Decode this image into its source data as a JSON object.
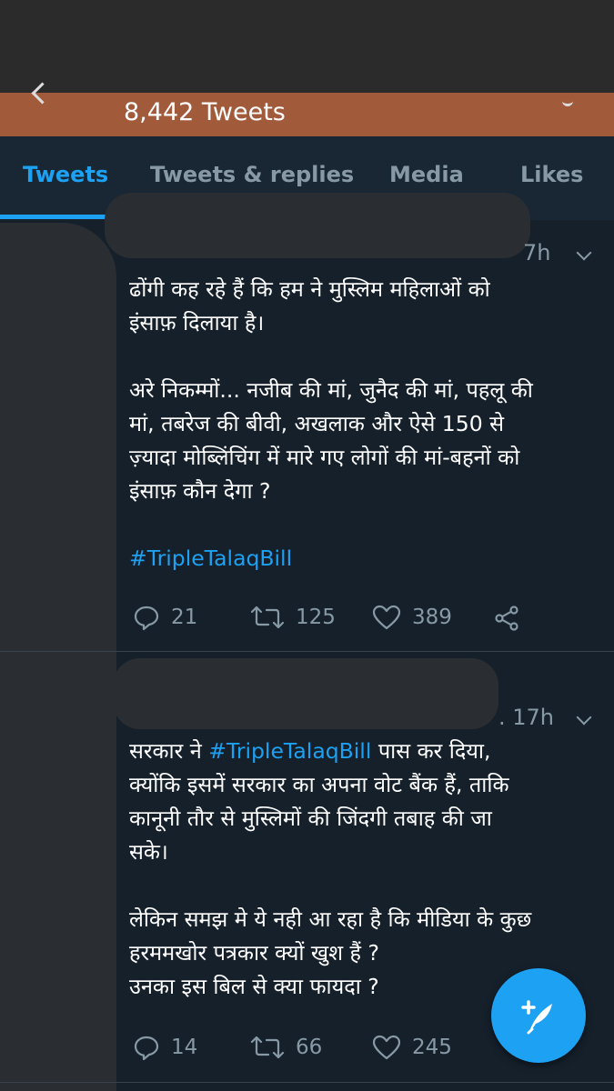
{
  "header": {
    "tweet_count": "8,442 Tweets"
  },
  "tabs": [
    {
      "label": "Tweets",
      "active": true
    },
    {
      "label": "Tweets & replies",
      "active": false
    },
    {
      "label": "Media",
      "active": false
    },
    {
      "label": "Likes",
      "active": false
    }
  ],
  "tweets": [
    {
      "time": "7h",
      "lines_para1": [
        "ढोंगी कह रहे हैं कि हम ने मुस्लिम महिलाओं को",
        "इंसाफ़ दिलाया है।"
      ],
      "lines_para2": [
        "अरे निकम्मों... नजीब की मां, जुनैद की मां, पहलू की",
        "मां, तबरेज की बीवी, अखलाक और ऐसे 150 से",
        "ज़्यादा मोब्लिंचिंग में मारे गए लोगों की मां-बहनों को",
        "इंसाफ़ कौन देगा ?"
      ],
      "hashtag": "#TripleTalaqBill",
      "replies": "21",
      "retweets": "125",
      "likes": "389"
    },
    {
      "time": ". 17h",
      "line1_before": "सरकार ने ",
      "line1_hashtag": "#TripleTalaqBill",
      "line1_after": " पास कर दिया,",
      "lines_para1_rest": [
        "क्योंकि इसमें सरकार का अपना वोट बैंक हैं, ताकि",
        "कानूनी तौर से मुस्लिमों की जिंदगी तबाह की जा",
        "सके।"
      ],
      "lines_para2": [
        "लेकिन समझ मे ये नही आ रहा है कि मीडिया के कुछ",
        "हरममखोर पत्रकार क्यों खुश हैं ?",
        "उनका इस बिल से क्या फायदा ?"
      ],
      "replies": "14",
      "retweets": "66",
      "likes": "245"
    }
  ],
  "colors": {
    "accent": "#1da1f2",
    "background": "#15202b",
    "secondary_text": "#8899a6"
  }
}
